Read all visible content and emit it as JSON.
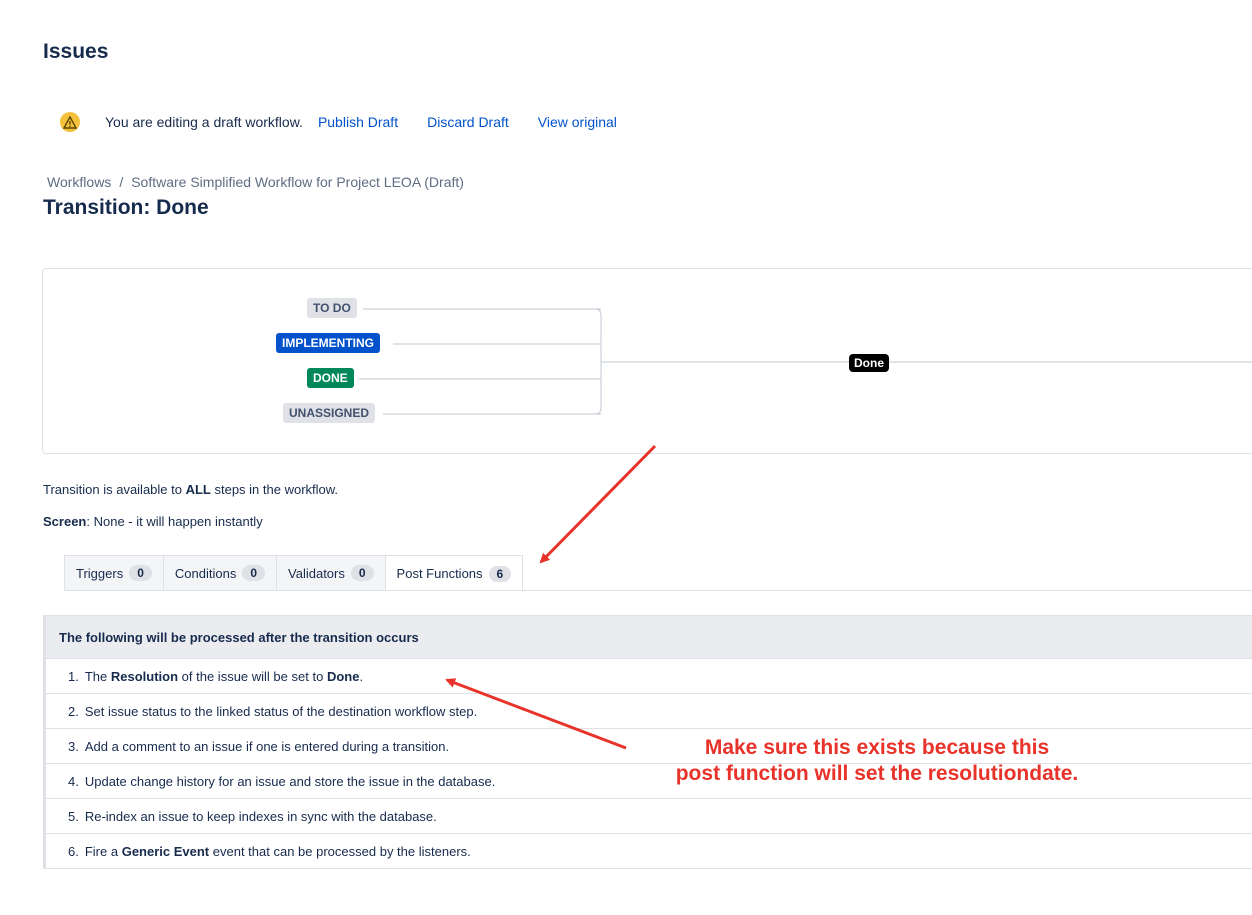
{
  "page": {
    "heading": "Issues"
  },
  "draft_bar": {
    "message": "You are editing a draft workflow.",
    "links": [
      "Publish Draft",
      "Discard Draft",
      "View original"
    ]
  },
  "breadcrumb": {
    "root": "Workflows",
    "separator": "/",
    "current": "Software Simplified Workflow for Project LEOA (Draft)"
  },
  "title": "Transition: Done",
  "diagram": {
    "statuses": [
      {
        "label": "TO DO",
        "color": "#dfe1e6"
      },
      {
        "label": "IMPLEMENTING",
        "color": "#0052cc"
      },
      {
        "label": "DONE",
        "color": "#00875a"
      },
      {
        "label": "UNASSIGNED",
        "color": "#dfe1e6"
      }
    ],
    "transition": "Done"
  },
  "info": {
    "availability_pre": "Transition is available to ",
    "availability_bold": "ALL",
    "availability_post": " steps in the workflow.",
    "screen_label": "Screen",
    "screen_value": ": None - it will happen instantly"
  },
  "tabs": [
    {
      "label": "Triggers",
      "count": "0"
    },
    {
      "label": "Conditions",
      "count": "0"
    },
    {
      "label": "Validators",
      "count": "0"
    },
    {
      "label": "Post Functions",
      "count": "6",
      "active": true
    }
  ],
  "post_functions": {
    "header": "The following will be processed after the transition occurs",
    "items": [
      {
        "num": "1.",
        "parts": [
          "The ",
          "Resolution",
          " of the issue will be set to ",
          "Done",
          "."
        ]
      },
      {
        "num": "2.",
        "text": "Set issue status to the linked status of the destination workflow step."
      },
      {
        "num": "3.",
        "text": "Add a comment to an issue if one is entered during a transition."
      },
      {
        "num": "4.",
        "text": "Update change history for an issue and store the issue in the database."
      },
      {
        "num": "5.",
        "text": "Re-index an issue to keep indexes in sync with the database."
      },
      {
        "num": "6.",
        "parts": [
          "Fire a ",
          "Generic Event",
          " event that can be processed by the listeners."
        ]
      }
    ]
  },
  "annotation": {
    "line1": "Make sure this exists because this",
    "line2": "post function will set the resolutiondate.",
    "color": "#e8332a"
  }
}
